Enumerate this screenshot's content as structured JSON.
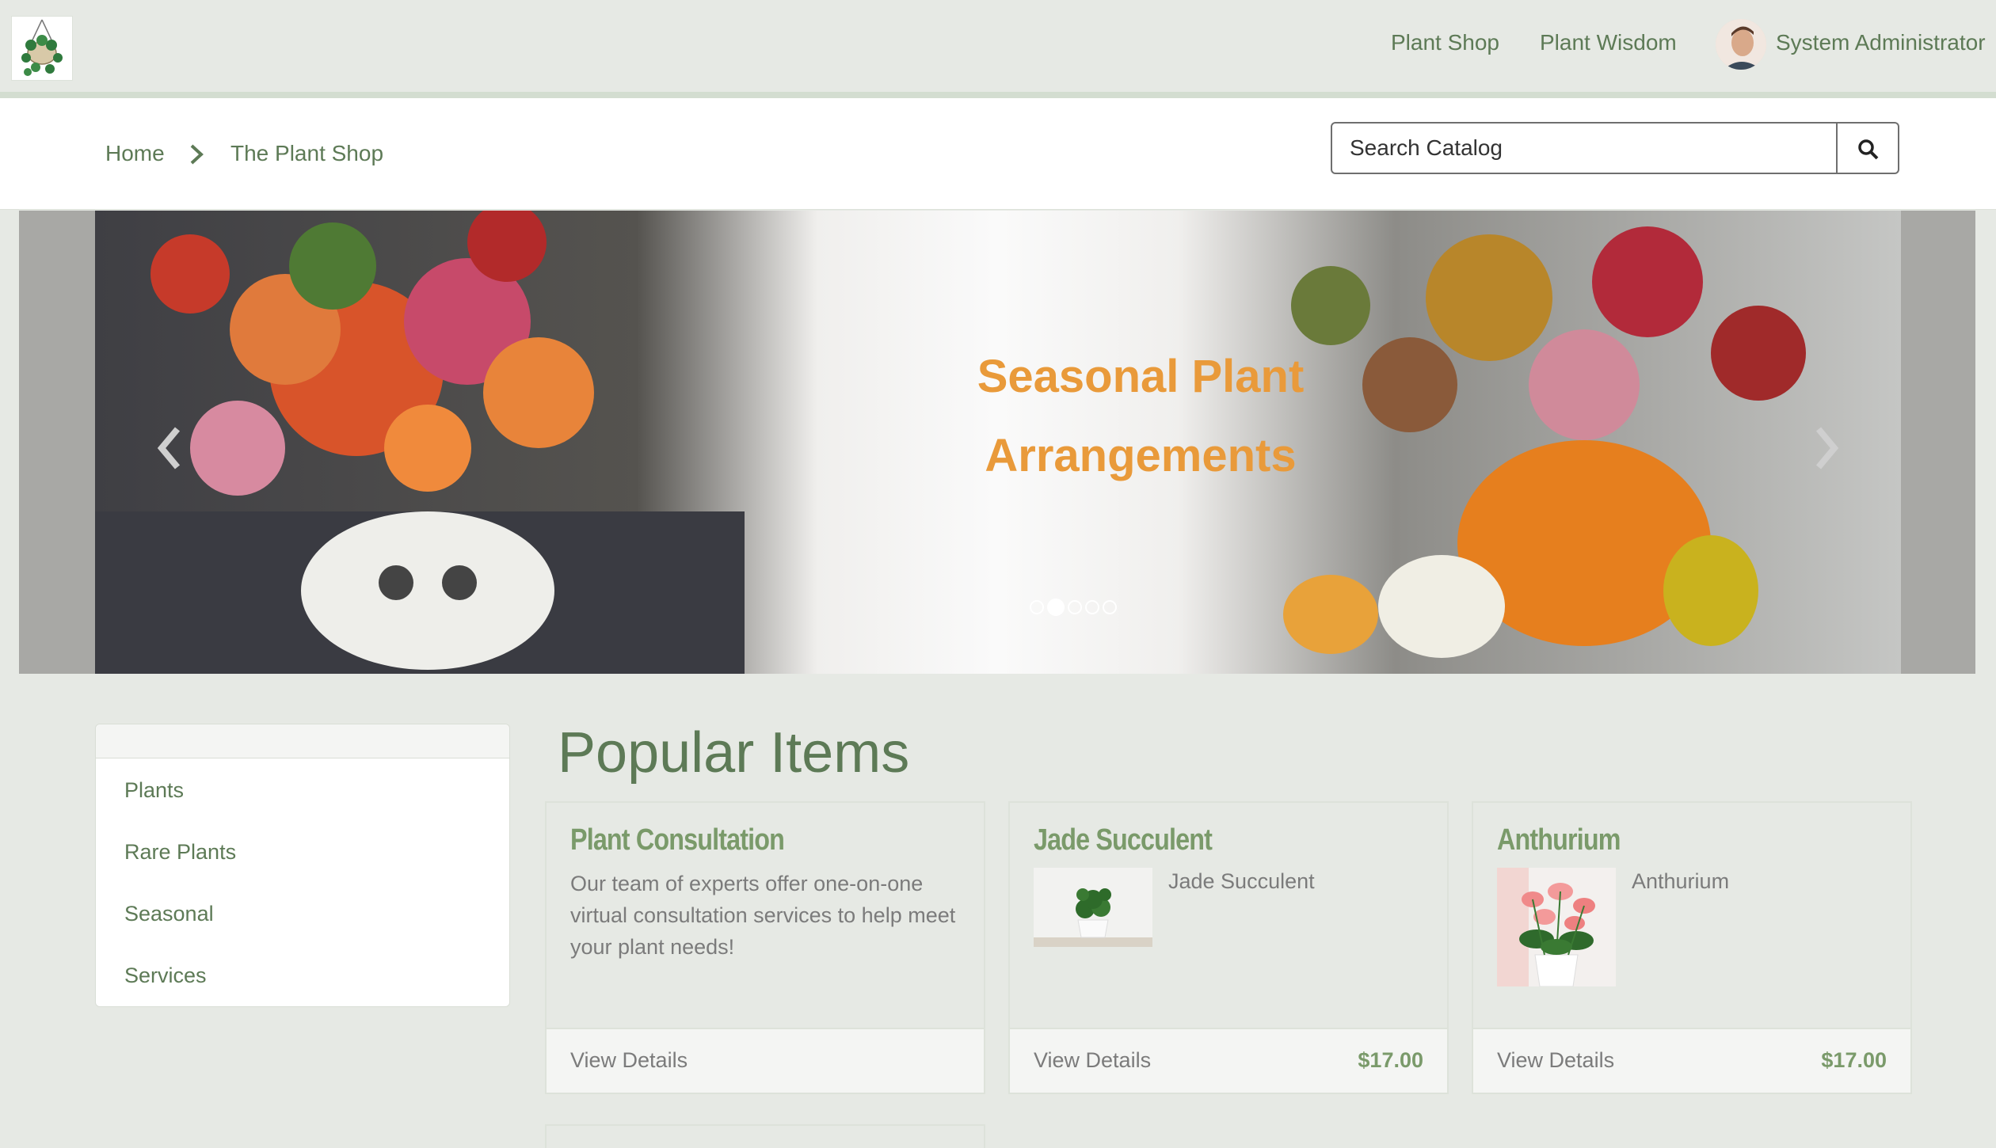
{
  "header": {
    "nav": [
      "Plant Shop",
      "Plant Wisdom"
    ],
    "user_name": "System Administrator"
  },
  "breadcrumb": {
    "home": "Home",
    "current": "The Plant Shop"
  },
  "search": {
    "placeholder": "Search Catalog"
  },
  "hero": {
    "title_line1": "Seasonal Plant",
    "title_line2": "Arrangements",
    "slide_count": 5,
    "active_slide": 2
  },
  "sidebar": {
    "items": [
      "Plants",
      "Rare Plants",
      "Seasonal",
      "Services"
    ]
  },
  "popular": {
    "title": "Popular Items",
    "cards": [
      {
        "title": "Plant Consultation",
        "desc": "Our team of experts offer one-on-one virtual consultation services to help meet your plant needs!",
        "footer": "View Details",
        "price": ""
      },
      {
        "title": "Jade Succulent",
        "subtitle": "Jade Succulent",
        "footer": "View Details",
        "price": "$17.00"
      },
      {
        "title": "Anthurium",
        "subtitle": "Anthurium",
        "footer": "View Details",
        "price": "$17.00"
      }
    ]
  },
  "colors": {
    "accent": "#5d7a56",
    "background": "#e6e9e4",
    "hero_title": "#e99a3a"
  }
}
